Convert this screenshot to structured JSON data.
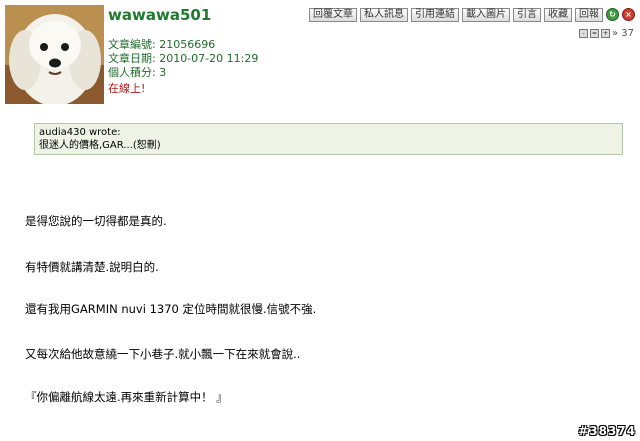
{
  "post": {
    "username": "wawawa501",
    "meta": [
      {
        "label": "文章編號: ",
        "value": "21056696"
      },
      {
        "label": "文章日期: ",
        "value": "2010-07-20 11:29"
      },
      {
        "label": "個人積分: ",
        "value": "3"
      }
    ],
    "online_status": "在線上!"
  },
  "toolbar": {
    "reply": "回覆文章",
    "pm": "私人訊息",
    "link": "引用連結",
    "upload": "載入圖片",
    "quote": "引言",
    "favorite": "收藏",
    "report": "回報"
  },
  "sizebar": {
    "count": "» 37"
  },
  "quote": {
    "author": "audia430 wrote:",
    "text": "很迷人的價格,GAR...(恕刪)"
  },
  "body": [
    "是得您說的一切得都是真的.",
    "有特價就講清楚.說明白的.",
    "還有我用GARMIN nuvi 1370 定位時間就很慢.信號不強.",
    "又每次給他故意繞一下小巷子.就小飄一下在來就會說..",
    "『你偏離航線太遠.再來重新計算中！ 』"
  ],
  "watermark": "#38374",
  "colors": {
    "username": "#1f7a2e",
    "meta": "#1f6b2a",
    "online": "#b01818",
    "quote_bg": "#eef3e6"
  }
}
